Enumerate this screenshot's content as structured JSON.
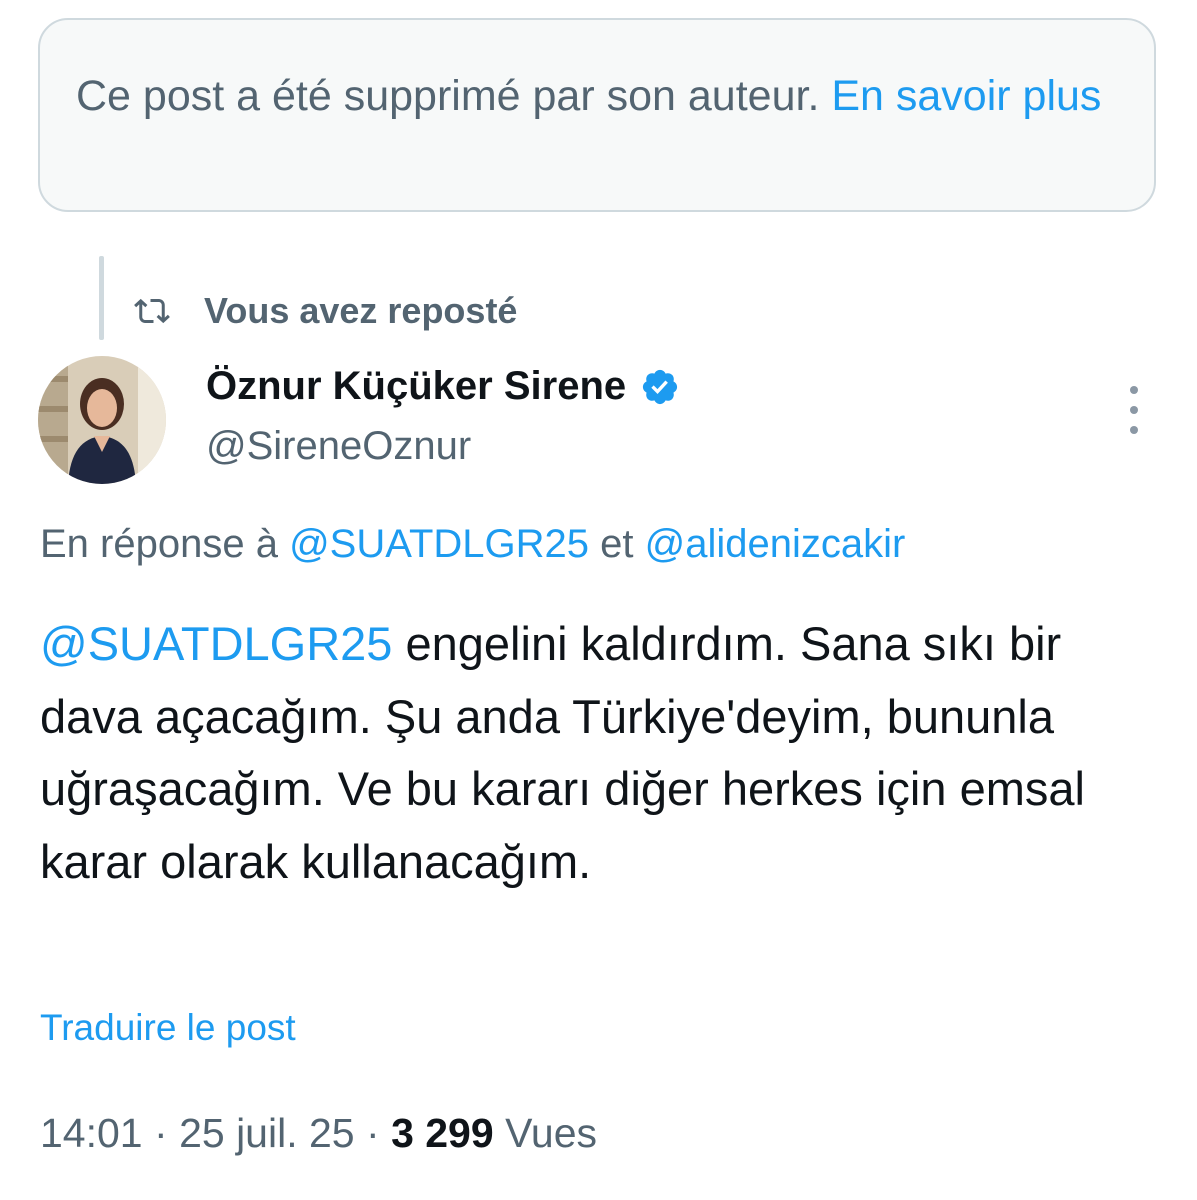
{
  "deleted_notice": {
    "text": "Ce post a été supprimé par son auteur.",
    "link_label": "En savoir plus"
  },
  "repost_header": {
    "icon": "repost-icon",
    "label": "Vous avez reposté"
  },
  "author": {
    "name": "Öznur Küçüker Sirene",
    "handle": "@SireneOznur",
    "verified_icon": "verified-badge-icon",
    "verified_color": "#1d9bf0"
  },
  "reply_context": {
    "prefix": "En réponse à",
    "mention1": "@SUATDLGR25",
    "conjunction": "et",
    "mention2": "@alidenizcakir"
  },
  "post": {
    "mention": "@SUATDLGR25",
    "text": "engelini kaldırdım. Sana sıkı bir dava açacağım. Şu anda Türkiye'deyim, bununla uğraşacağım. Ve bu kararı diğer herkes için emsal karar olarak kullanacağım."
  },
  "translate_label": "Traduire le post",
  "meta": {
    "time": "14:01",
    "separator": "·",
    "date": "25 juil. 25",
    "views_count": "3 299",
    "views_label": "Vues"
  },
  "colors": {
    "accent": "#1d9bf0",
    "secondary_text": "#536471",
    "primary_text": "#0f1419",
    "border": "#cfd9de"
  }
}
